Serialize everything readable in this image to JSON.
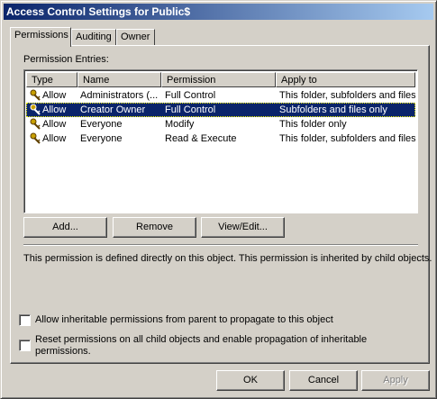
{
  "window": {
    "title": "Access Control Settings for Public$"
  },
  "tabs": [
    {
      "label": "Permissions"
    },
    {
      "label": "Auditing"
    },
    {
      "label": "Owner"
    }
  ],
  "permissions": {
    "entries_label": "Permission Entries:",
    "columns": [
      "Type",
      "Name",
      "Permission",
      "Apply to"
    ],
    "rows": [
      {
        "type": "Allow",
        "name": "Administrators (...",
        "permission": "Full Control",
        "apply_to": "This folder, subfolders and files",
        "icon": "key-user-icon",
        "selected": false
      },
      {
        "type": "Allow",
        "name": "Creator Owner",
        "permission": "Full Control",
        "apply_to": "Subfolders and files only",
        "icon": "key-user-icon",
        "selected": true
      },
      {
        "type": "Allow",
        "name": "Everyone",
        "permission": "Modify",
        "apply_to": "This folder only",
        "icon": "key-user-icon",
        "selected": false
      },
      {
        "type": "Allow",
        "name": "Everyone",
        "permission": "Read & Execute",
        "apply_to": "This folder, subfolders and files",
        "icon": "key-user-icon",
        "selected": false
      }
    ],
    "buttons": {
      "add": "Add...",
      "remove": "Remove",
      "view_edit": "View/Edit..."
    },
    "description": "This permission is defined directly on this object. This permission is inherited by child objects.",
    "checkbox_inherit": "Allow inheritable permissions from parent to propagate to this object",
    "checkbox_reset_line1": "Reset permissions on all child objects and enable propagation of inheritable",
    "checkbox_reset_line2": "permissions."
  },
  "dialog_buttons": {
    "ok": "OK",
    "cancel": "Cancel",
    "apply": "Apply"
  },
  "colors": {
    "selection": "#0a246a",
    "face": "#d4d0c8",
    "title_start": "#0a246a",
    "title_end": "#a6caf0"
  }
}
